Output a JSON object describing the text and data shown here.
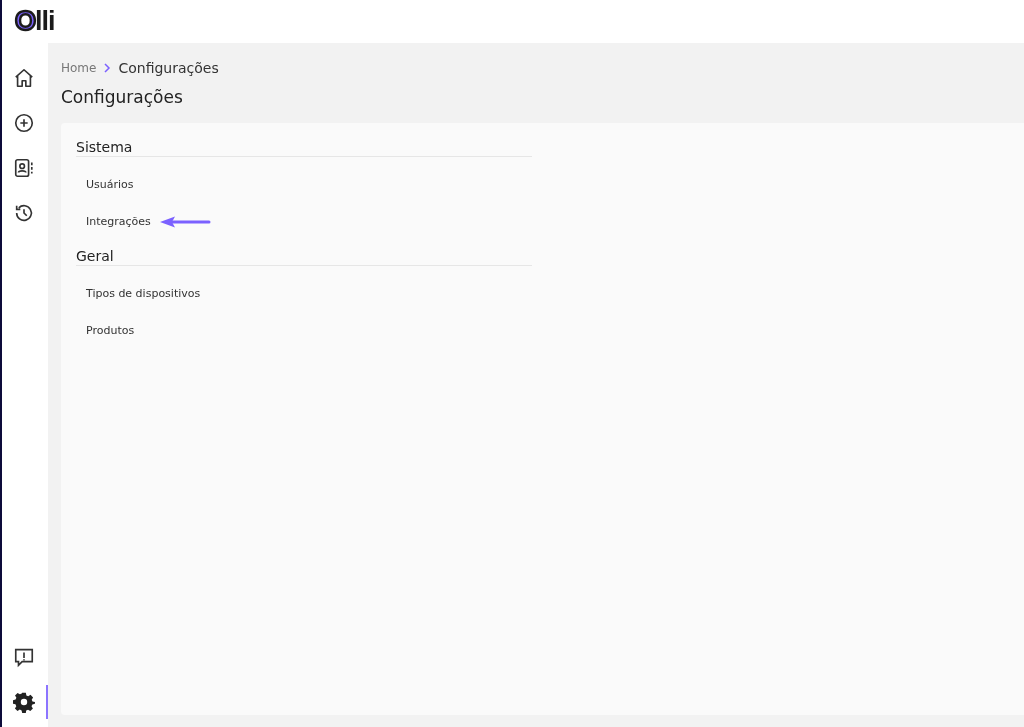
{
  "logo": "Olli",
  "nav": [
    {
      "kind": "home",
      "selected": false
    },
    {
      "kind": "add",
      "selected": false
    },
    {
      "kind": "contacts",
      "selected": false
    },
    {
      "kind": "history",
      "selected": false
    }
  ],
  "nav_bottom": [
    {
      "kind": "feedback",
      "selected": false
    },
    {
      "kind": "settings",
      "selected": true
    }
  ],
  "breadcrumb": [
    "Home",
    "Configurações"
  ],
  "page_title": "Configurações",
  "sections": [
    {
      "title": "Sistema",
      "items": [
        {
          "label": "Usuários",
          "pointed": false
        },
        {
          "label": "Integrações",
          "pointed": true
        }
      ]
    },
    {
      "title": "Geral",
      "items": [
        {
          "label": "Tipos de dispositivos",
          "pointed": false
        },
        {
          "label": "Produtos",
          "pointed": false
        }
      ]
    }
  ]
}
